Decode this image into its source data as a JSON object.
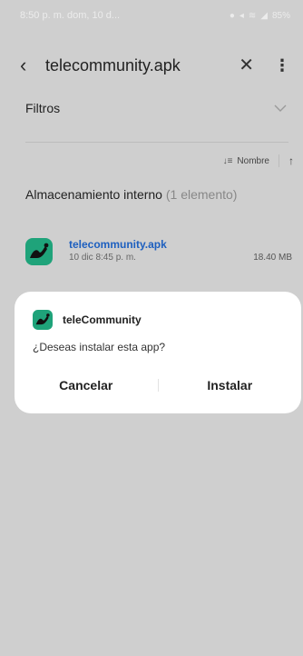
{
  "status_bar": {
    "time_date": "8:50 p. m.  dom, 10 d...",
    "battery": "85%"
  },
  "app_bar": {
    "title": "telecommunity.apk",
    "icons": [
      "back-icon",
      "close-icon",
      "more-icon"
    ]
  },
  "filters": {
    "label": "Filtros"
  },
  "sort": {
    "label": "Nombre"
  },
  "section": {
    "title": "Almacenamiento interno",
    "count": "(1 elemento)"
  },
  "file": {
    "name": "telecommunity.apk",
    "date": "10 dic 8:45 p. m.",
    "size": "18.40 MB"
  },
  "dialog": {
    "app_name": "teleCommunity",
    "question": "¿Deseas instalar esta app?",
    "cancel_label": "Cancelar",
    "install_label": "Instalar"
  },
  "colors": {
    "overlay_bg": "#cfcfcf",
    "app_icon_bg": "#1fa37a",
    "link_blue": "#1d5fbf",
    "dialog_bg": "#ffffff"
  }
}
